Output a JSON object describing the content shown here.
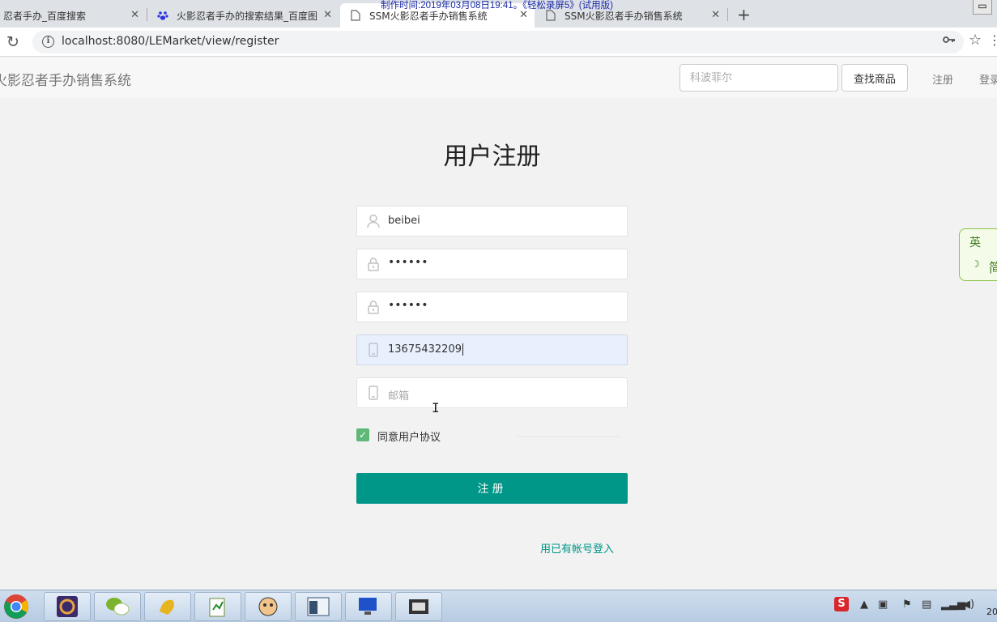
{
  "browser": {
    "tabs": [
      {
        "title": "忍者手办_百度搜索",
        "icon": "paw-icon"
      },
      {
        "title": "火影忍者手办的搜索结果_百度图",
        "icon": "paw-icon"
      },
      {
        "title": "SSM火影忍者手办销售系统",
        "icon": "page-icon",
        "active": true
      },
      {
        "title": "SSM火影忍者手办销售系统",
        "icon": "page-icon"
      }
    ],
    "new_tab_label": "+",
    "watermark": "制作时间:2019年03月08日19:41。《轻松录屏5》(试用版)",
    "url": "localhost:8080/LEMarket/view/register"
  },
  "navbar": {
    "brand": "火影忍者手办销售系统",
    "search_placeholder": "科波菲尔",
    "search_button": "查找商品",
    "register_link": "注册",
    "login_link": "登录"
  },
  "form": {
    "title": "用户注册",
    "username_value": "beibei",
    "password_value": "••••••",
    "confirm_password_value": "••••••",
    "phone_value": "13675432209",
    "email_placeholder": "邮箱",
    "agree_label": "同意用户协议",
    "agree_checked": true,
    "submit_label": "注册",
    "login_link": "用已有帐号登入",
    "accent_color": "#009688"
  },
  "side_widget": {
    "line1": "英",
    "line2": "☽",
    "line3": "简"
  },
  "taskbar": {
    "tray_s": "S",
    "clock": "20"
  }
}
